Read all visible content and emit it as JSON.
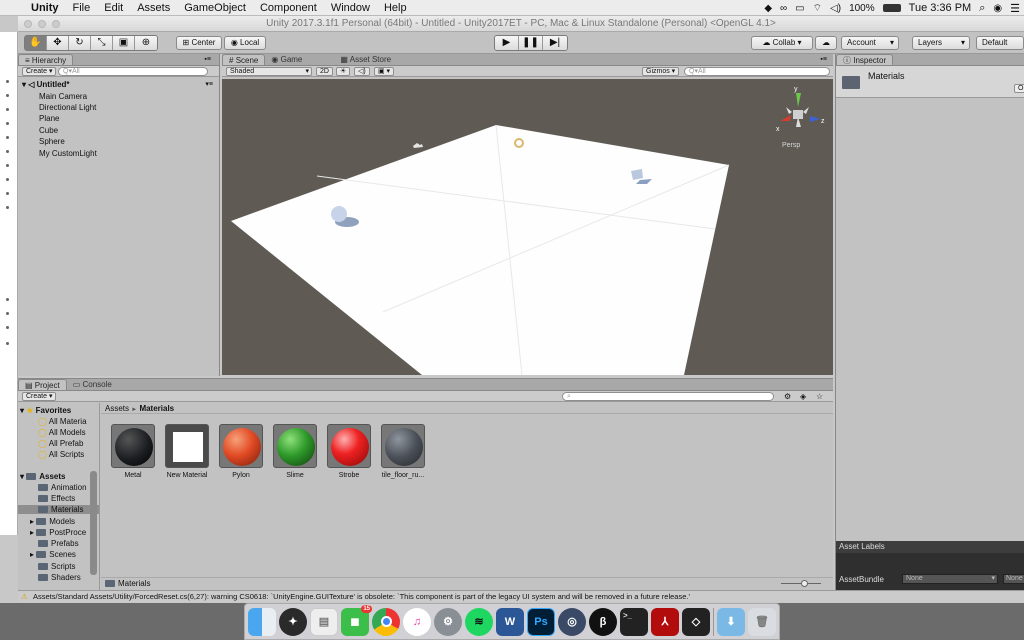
{
  "menubar": {
    "app_name": "Unity",
    "items": [
      "File",
      "Edit",
      "Assets",
      "GameObject",
      "Component",
      "Window",
      "Help"
    ],
    "battery": "100%",
    "clock": "Tue 3:36 PM"
  },
  "window": {
    "title": "Unity 2017.3.1f1 Personal (64bit) - Untitled - Unity2017ET - PC, Mac & Linux Standalone (Personal) <OpenGL 4.1>"
  },
  "toolbar": {
    "pivot_label": "Center",
    "space_label": "Local",
    "collab_label": "Collab",
    "account_label": "Account",
    "layers_label": "Layers",
    "layout_label": "Default"
  },
  "hierarchy": {
    "tab": "Hierarchy",
    "create_label": "Create",
    "search_placeholder": "Q▾All",
    "scene_name": "Untitled*",
    "items": [
      "Main Camera",
      "Directional Light",
      "Plane",
      "Cube",
      "Sphere",
      "My CustomLight"
    ]
  },
  "scene": {
    "tabs": [
      "Scene",
      "Game",
      "Asset Store"
    ],
    "shading_mode": "Shaded",
    "mode_2d": "2D",
    "gizmos_label": "Gizmos",
    "search_placeholder": "Q▾All",
    "persp_label": "Persp",
    "axis_labels": {
      "x": "x",
      "y": "y",
      "z": "z"
    }
  },
  "inspector": {
    "tab": "Inspector",
    "object_name": "Materials",
    "open_button": "Op",
    "asset_labels": "Asset Labels",
    "asset_bundle_label": "AssetBundle",
    "asset_bundle_value": "None",
    "asset_variant_value": "None"
  },
  "project": {
    "tabs": [
      "Project",
      "Console"
    ],
    "create_label": "Create",
    "breadcrumb_root": "Assets",
    "breadcrumb_separator": "►",
    "breadcrumb_current": "Materials",
    "favorites_label": "Favorites",
    "favorites": [
      "All Materia",
      "All Models",
      "All Prefab",
      "All Scripts"
    ],
    "assets_label": "Assets",
    "folders": [
      "Animation",
      "Effects",
      "Materials",
      "Models",
      "PostProce",
      "Prefabs",
      "Scenes",
      "Scripts",
      "Shaders"
    ],
    "materials": [
      {
        "name": "Metal",
        "color": "#1b1d21"
      },
      {
        "name": "New Material",
        "color": "#ffffff"
      },
      {
        "name": "Pylon",
        "color": "#e24b25"
      },
      {
        "name": "Slime",
        "color": "#2e9a2a"
      },
      {
        "name": "Strobe",
        "color": "#ee2222"
      },
      {
        "name": "tile_floor_ru...",
        "color": "#4b5058"
      }
    ],
    "footer_path": "Materials"
  },
  "status": {
    "message": "Assets/Standard Assets/Utility/ForcedReset.cs(6,27): warning CS0618: `UnityEngine.GUITexture' is obsolete: `This component is part of the legacy UI system and will be removed in a future release.'"
  },
  "dock": {
    "apps": [
      "finder",
      "safari",
      "notes",
      "facetime",
      "chrome",
      "itunes",
      "system-prefs",
      "spotify",
      "word",
      "photoshop",
      "quicktime",
      "pycharm",
      "terminal",
      "acrobat",
      "unity",
      "downloads",
      "trash"
    ],
    "facetime_badge": "15",
    "photoshop_label": "Ps",
    "word_label": "W"
  },
  "colors": {
    "panel_gray": "#c2c2c2",
    "scene_bg": "#5f5a54",
    "selection_blue": "#3d6fb6"
  }
}
